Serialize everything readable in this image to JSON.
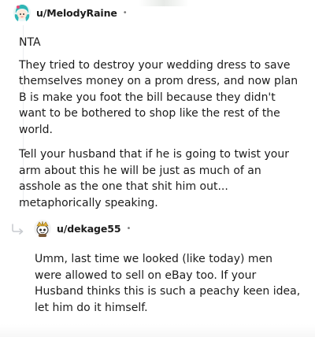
{
  "comments": [
    {
      "username": "u/MelodyRaine",
      "separator": "•",
      "avatar_icon": "anime-girl-avatar-icon",
      "paragraphs": [
        "NTA",
        "They tried to destroy your wedding dress to save themselves money on a prom dress, and now plan B is make you foot the bill because they didn't want to be bothered to shop like the rest of the world.",
        "Tell your husband that if he is going to twist your arm about this he will be just as much of an asshole as the one that shit him out... metaphorically speaking."
      ]
    },
    {
      "username": "u/dekage55",
      "separator": "•",
      "avatar_icon": "snoo-avatar-icon",
      "reply_icon": "reply-arrow-icon",
      "paragraphs": [
        "Umm, last time we looked (like today) men were allowed to sell on eBay too. If your Husband thinks this is such a peachy keen idea, let him do it himself."
      ]
    }
  ],
  "colors": {
    "text": "#1c1c1c",
    "muted": "#7c7c7c",
    "thread_line": "#edeff1"
  }
}
